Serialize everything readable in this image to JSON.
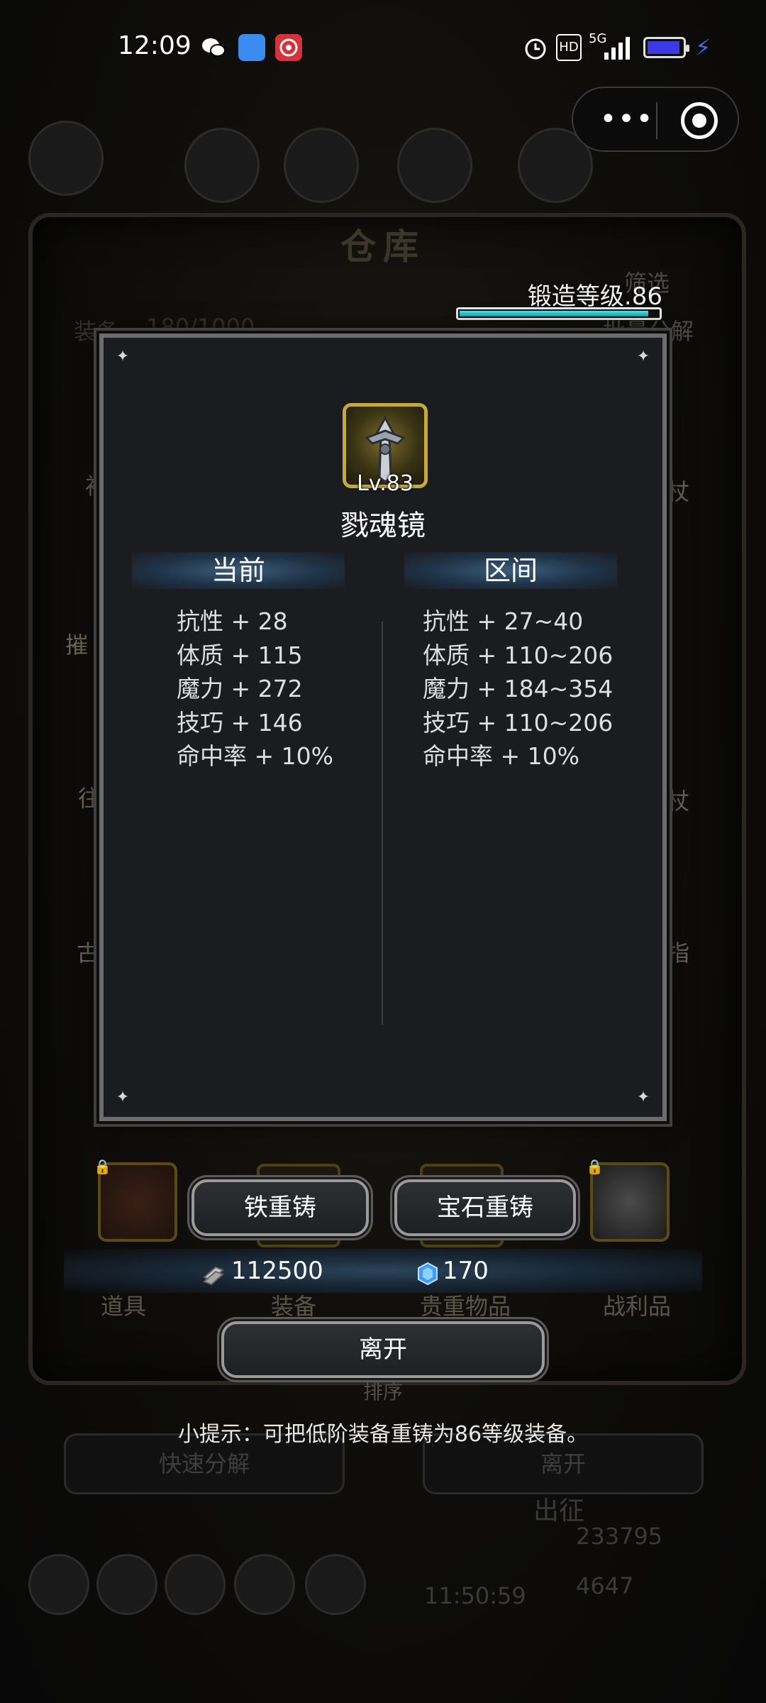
{
  "status_bar": {
    "time": "12:09",
    "icons": [
      "wechat-icon",
      "qq-browser-icon",
      "target-app-icon",
      "alarm-icon",
      "hd-icon",
      "5g-signal-icon",
      "battery-icon",
      "charging-icon"
    ],
    "network": "5G",
    "hd": "HD"
  },
  "mini_program_capsule": {
    "more": "•••",
    "close": "◉"
  },
  "forge": {
    "label": "锻造等级.86",
    "progress": 0.95
  },
  "item": {
    "level": "Lv.83",
    "name": "戮魂镜"
  },
  "columns": {
    "current": {
      "header": "当前",
      "stats": [
        "抗性 + 28",
        "体质 + 115",
        "魔力 + 272",
        "技巧 + 146",
        "命中率 + 10%"
      ]
    },
    "range": {
      "header": "区间",
      "stats": [
        "抗性 + 27~40",
        "体质 + 110~206",
        "魔力 + 184~354",
        "技巧 + 110~206",
        "命中率 + 10%"
      ]
    }
  },
  "actions": {
    "iron_reforge": "铁重铸",
    "gem_reforge": "宝石重铸",
    "leave": "离开"
  },
  "costs": {
    "silver": "112500",
    "gem": "170"
  },
  "tip": "小提示：可把低阶装备重铸为86等级装备。",
  "background": {
    "title": "仓库",
    "equip_count_label": "装备",
    "equip_count": "180/1000",
    "filter": "筛选",
    "batch": "批量分解",
    "tabs": [
      "道具",
      "装备",
      "贵重物品",
      "战利品"
    ],
    "sort": "排序",
    "quick_decompose": "快速分解",
    "leave": "离开",
    "depart": "出征",
    "gold": "233795",
    "gems": "4647",
    "timer": "11:50:59",
    "side_labels": [
      "摧",
      "衫",
      "古",
      "杖",
      "杖",
      "指",
      "往"
    ]
  }
}
